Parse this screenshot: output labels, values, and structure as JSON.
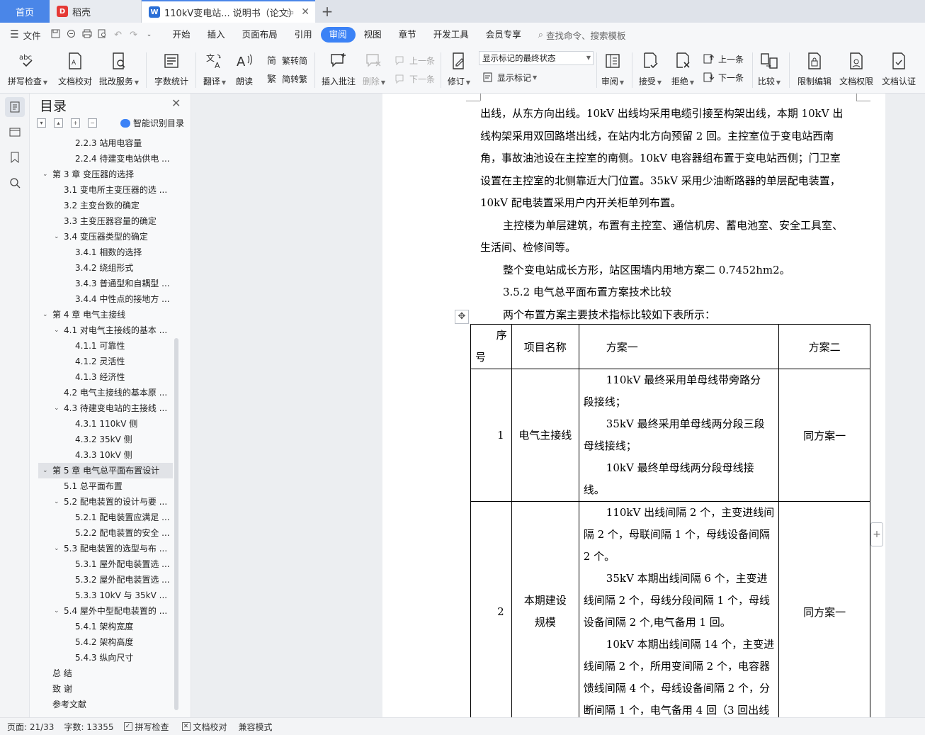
{
  "tabs": {
    "home": "首页",
    "daoke": "稻壳",
    "active_doc": "110kV变电站... 说明书（论文）",
    "add": "+"
  },
  "menu": {
    "file": "文件",
    "items": [
      "开始",
      "插入",
      "页面布局",
      "引用",
      "审阅",
      "视图",
      "章节",
      "开发工具",
      "会员专享"
    ],
    "active": "审阅",
    "search": "查找命令、搜索模板"
  },
  "ribbon": {
    "spellcheck": "拼写检查",
    "doc_proof": "文档校对",
    "batch_service": "批改服务",
    "word_count": "字数统计",
    "translate": "翻译",
    "read_aloud": "朗读",
    "trad_convert": "繁转简",
    "simp_convert": "简转繁",
    "insert_comment": "插入批注",
    "delete": "删除",
    "prev_comment": "上一条",
    "next_comment": "下一条",
    "revise": "修订",
    "markup_state": "显示标记的最终状态",
    "show_markup": "显示标记",
    "review": "审阅",
    "accept": "接受",
    "reject": "拒绝",
    "prev_change": "上一条",
    "next_change": "下一条",
    "compare": "比较",
    "restrict_edit": "限制编辑",
    "doc_permission": "文档权限",
    "doc_cert": "文档认证"
  },
  "toc": {
    "title": "目录",
    "smart_toc": "智能识别目录",
    "items": [
      {
        "text": "2.2.3  站用电容量",
        "level": 3
      },
      {
        "text": "2.2.4  待建变电站供电 ...",
        "level": 3
      },
      {
        "text": "第 3 章  变压器的选择",
        "level": 1,
        "expand": true
      },
      {
        "text": "3.1 变电所主变压器的选 ...",
        "level": 2
      },
      {
        "text": "3.2 主变台数的确定",
        "level": 2
      },
      {
        "text": "3.3 主变压器容量的确定",
        "level": 2
      },
      {
        "text": "3.4  变压器类型的确定",
        "level": 2,
        "expand": true
      },
      {
        "text": "3.4.1 相数的选择",
        "level": 3
      },
      {
        "text": "3.4.2  绕组形式",
        "level": 3
      },
      {
        "text": "3.4.3  普通型和自耦型 ...",
        "level": 3
      },
      {
        "text": "3.4.4  中性点的接地方 ...",
        "level": 3
      },
      {
        "text": "第 4 章  电气主接线",
        "level": 1,
        "expand": true
      },
      {
        "text": "4.1 对电气主接线的基本 ...",
        "level": 2,
        "expand": true
      },
      {
        "text": "4.1.1 可靠性",
        "level": 3
      },
      {
        "text": "4.1.2 灵活性",
        "level": 3
      },
      {
        "text": "4.1.3 经济性",
        "level": 3
      },
      {
        "text": "4.2 电气主接线的基本原 ...",
        "level": 2
      },
      {
        "text": "4.3 待建变电站的主接线 ...",
        "level": 2,
        "expand": true
      },
      {
        "text": "4.3.1 110kV 侧",
        "level": 3
      },
      {
        "text": "4.3.2 35kV 侧",
        "level": 3
      },
      {
        "text": "4.3.3 10kV 侧",
        "level": 3
      },
      {
        "text": "第 5 章  电气总平面布置设计",
        "level": 1,
        "expand": true,
        "selected": true
      },
      {
        "text": "5.1 总平面布置",
        "level": 2
      },
      {
        "text": "5.2 配电装置的设计与要 ...",
        "level": 2,
        "expand": true
      },
      {
        "text": "5.2.1  配电装置应满足 ...",
        "level": 3
      },
      {
        "text": "5.2.2  配电装置的安全 ...",
        "level": 3
      },
      {
        "text": "5.3  配电装置的选型与布 ...",
        "level": 2,
        "expand": true
      },
      {
        "text": "5.3.1  屋外配电装置选 ...",
        "level": 3
      },
      {
        "text": "5.3.2  屋外配电装置选 ...",
        "level": 3
      },
      {
        "text": "5.3.3 10kV 与 35kV  ...",
        "level": 3
      },
      {
        "text": "5.4 屋外中型配电装置的 ...",
        "level": 2,
        "expand": true
      },
      {
        "text": "5.4.1 架构宽度",
        "level": 3
      },
      {
        "text": "5.4.2 架构高度",
        "level": 3
      },
      {
        "text": "5.4.3 纵向尺寸",
        "level": 3
      },
      {
        "text": "总    结",
        "level": 1
      },
      {
        "text": "致    谢",
        "level": 1
      },
      {
        "text": "参考文献",
        "level": 1
      }
    ]
  },
  "document": {
    "lines": [
      {
        "text": "出线，从东方向出线。10kV 出线均采用电缆引接至构架出线，本期 10kV 出",
        "indent": false
      },
      {
        "text": "线构架采用双回路塔出线，在站内北方向预留 2 回。主控室位于变电站西南",
        "indent": false
      },
      {
        "text": "角，事故油池设在主控室的南侧。10kV 电容器组布置于变电站西侧；门卫室",
        "indent": false
      },
      {
        "text": "设置在主控室的北侧靠近大门位置。35kV 采用少油断路器的单层配电装置，",
        "indent": false
      },
      {
        "text": "10kV 配电装置采用户内开关柜单列布置。",
        "indent": false
      },
      {
        "text": "主控楼为单层建筑，布置有主控室、通信机房、蓄电池室、安全工具室、",
        "indent": true
      },
      {
        "text": "生活间、检修间等。",
        "indent": false
      },
      {
        "text": "整个变电站成长方形，站区围墙内用地方案二 0.7452hm2。",
        "indent": true
      },
      {
        "text": "3.5.2  电气总平面布置方案技术比较",
        "indent": true
      },
      {
        "text": "两个布置方案主要技术指标比较如下表所示：",
        "indent": true
      }
    ],
    "table": {
      "headers": {
        "seq_a": "序",
        "seq_b": "号",
        "name": "项目名称",
        "opt1": "方案一",
        "opt2": "方案二"
      },
      "rows": [
        {
          "seq": "1",
          "name_lines": [
            "电气主接线"
          ],
          "opt1_paras": [
            [
              "110kV 最终采用单母线带旁路分",
              "段接线；"
            ],
            [
              "35kV 最终采用单母线两分段三段",
              "母线接线；"
            ],
            [
              "10kV 最终单母线两分段母线接",
              "线。"
            ]
          ],
          "opt2": "同方案一"
        },
        {
          "seq": "2",
          "name_lines": [
            "本期建设",
            "规模"
          ],
          "opt1_paras": [
            [
              "110kV 出线间隔 2 个，主变进线间",
              "隔 2 个，母联间隔 1 个，母线设备间隔",
              "2 个。"
            ],
            [
              "35kV 本期出线间隔 6 个，主变进",
              "线间隔 2 个，母线分段间隔 1 个，母线",
              "设备间隔 2 个,电气备用 1 回。"
            ],
            [
              "10kV 本期出线间隔 14 个，主变进",
              "线间隔 2 个，所用变间隔 2 个，电容器",
              "馈线间隔 4 个，母线设备间隔 2 个，分",
              "断间隔 1 个，电气备用 4 回（3 回出线"
            ]
          ],
          "opt2": "同方案一"
        }
      ]
    }
  },
  "status": {
    "page": "页面: 21/33",
    "words": "字数: 13355",
    "spell": "拼写检查",
    "proof": "文档校对",
    "compat": "兼容模式"
  },
  "colors": {
    "accent": "#3b82f6",
    "home_tab": "#4a86e8",
    "daoke_red": "#e53935",
    "wps_blue": "#2b6fd6"
  }
}
